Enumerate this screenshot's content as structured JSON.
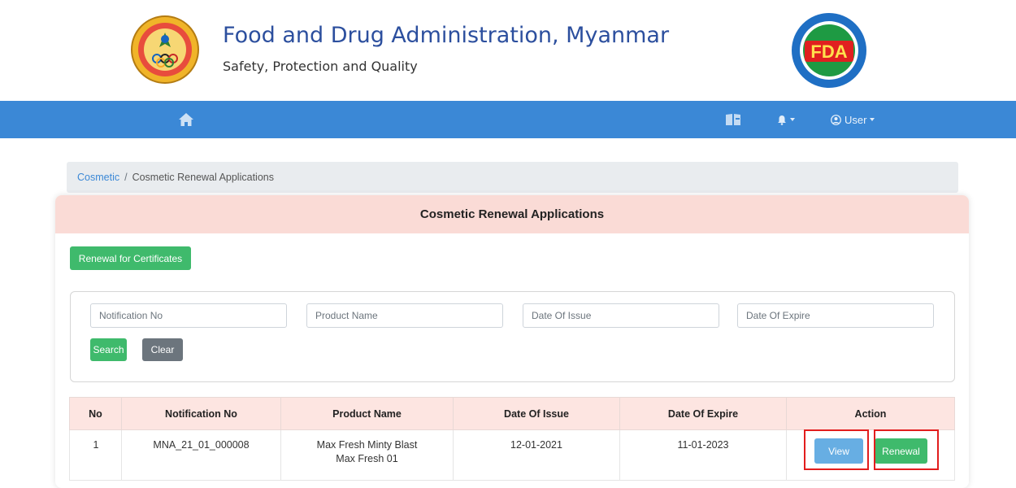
{
  "header": {
    "title": "Food and Drug Administration, Myanmar",
    "tagline": "Safety, Protection and Quality",
    "right_logo_text": "FDA",
    "brand_blue": "#2c4f9e",
    "fda_green": "#1e9a43",
    "fda_red": "#e02020"
  },
  "navbar": {
    "color": "#3b88d6",
    "home_icon": "home-icon",
    "book_icon": "book-icon",
    "bell_icon": "bell-icon",
    "user_icon": "user-circle-icon",
    "user_label": "User"
  },
  "breadcrumb": {
    "parent": "Cosmetic",
    "separator": "/",
    "current": "Cosmetic Renewal Applications"
  },
  "card": {
    "title": "Cosmetic Renewal Applications",
    "renewal_for_certificates_label": "Renewal for Certificates"
  },
  "search": {
    "notification_no_placeholder": "Notification No",
    "product_name_placeholder": "Product Name",
    "date_of_issue_placeholder": "Date Of Issue",
    "date_of_expire_placeholder": "Date Of Expire",
    "search_label": "Search",
    "clear_label": "Clear"
  },
  "table": {
    "headers": {
      "no": "No",
      "notification_no": "Notification No",
      "product_name": "Product Name",
      "date_of_issue": "Date Of Issue",
      "date_of_expire": "Date Of Expire",
      "action": "Action"
    },
    "rows": [
      {
        "no": "1",
        "notification_no": "MNA_21_01_000008",
        "product_name_line1": "Max Fresh Minty Blast",
        "product_name_line2": "Max Fresh 01",
        "date_of_issue": "12-01-2021",
        "date_of_expire": "11-01-2023",
        "view_label": "View",
        "renewal_label": "Renewal"
      }
    ]
  },
  "colors": {
    "green_button": "#3fba6c",
    "gray_button": "#6c757d",
    "blue_button": "#67aee3",
    "card_header": "#fadbd6",
    "highlight_red": "#e21d1d"
  }
}
